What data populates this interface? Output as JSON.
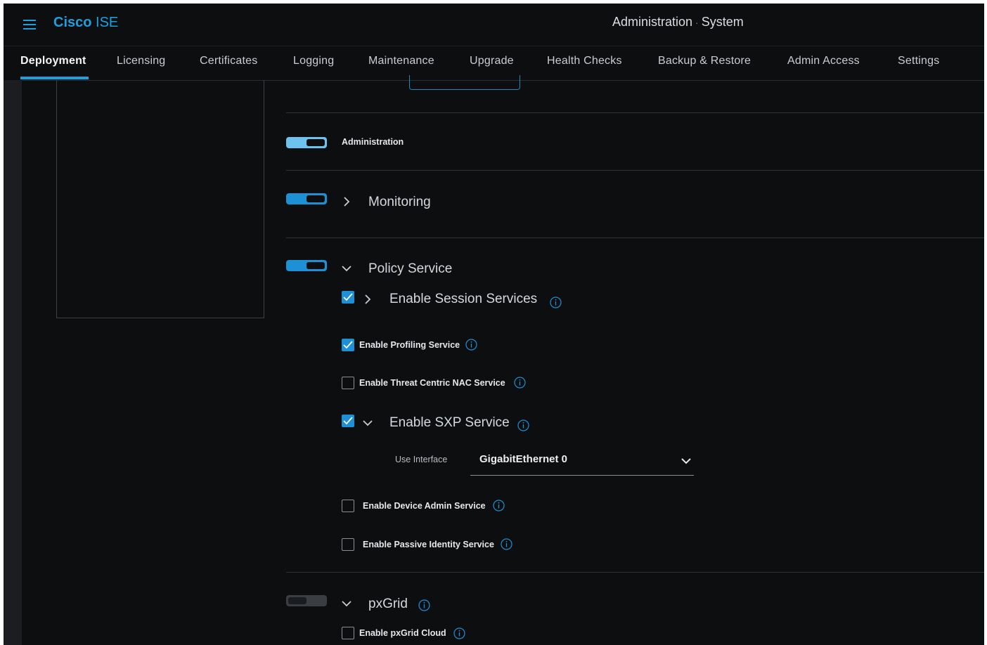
{
  "header": {
    "brand_bold": "Cisco",
    "brand_light": "ISE",
    "title_part1": "Administration",
    "title_separator": "·",
    "title_part2": "System"
  },
  "tabs": [
    {
      "label": "Deployment",
      "active": true
    },
    {
      "label": "Licensing"
    },
    {
      "label": "Certificates"
    },
    {
      "label": "Logging"
    },
    {
      "label": "Maintenance"
    },
    {
      "label": "Upgrade"
    },
    {
      "label": "Health Checks"
    },
    {
      "label": "Backup & Restore"
    },
    {
      "label": "Admin Access"
    },
    {
      "label": "Settings"
    }
  ],
  "personas": {
    "administration": {
      "label": "Administration",
      "enabled": true
    },
    "monitoring": {
      "label": "Monitoring",
      "enabled": true
    },
    "policy_service": {
      "label": "Policy Service",
      "enabled": true
    },
    "pxgrid": {
      "label": "pxGrid",
      "enabled": false
    }
  },
  "policy_options": {
    "session_services": {
      "label": "Enable Session Services",
      "checked": true
    },
    "profiling": {
      "label": "Enable Profiling Service",
      "checked": true
    },
    "threat_centric_nac": {
      "label": "Enable Threat Centric NAC Service",
      "checked": false
    },
    "sxp": {
      "label": "Enable SXP Service",
      "checked": true
    },
    "use_interface_label": "Use Interface",
    "use_interface_value": "GigabitEthernet 0",
    "device_admin": {
      "label": "Enable Device Admin Service",
      "checked": false
    },
    "passive_identity": {
      "label": "Enable Passive Identity Service",
      "checked": false
    }
  },
  "pxgrid_options": {
    "pxgrid_cloud": {
      "label": "Enable pxGrid Cloud",
      "checked": false
    }
  },
  "colors": {
    "accent": "#1ea0e0",
    "background": "#0d0e10",
    "toggle_on": "#1e90d6"
  },
  "icons": [
    "hamburger-menu-icon",
    "chevron-right-icon",
    "chevron-down-icon",
    "checkmark-icon",
    "info-icon"
  ]
}
